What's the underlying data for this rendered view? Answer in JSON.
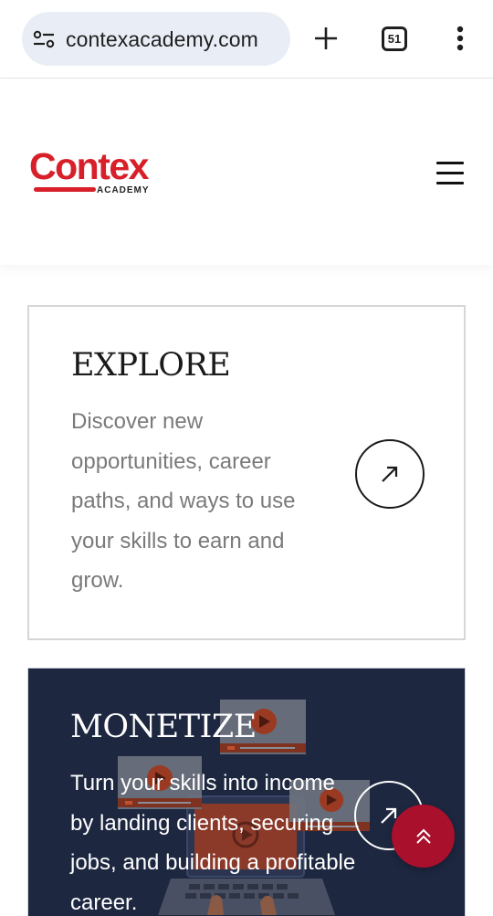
{
  "browser": {
    "url": "contexacademy.com",
    "tab_count": "51",
    "icons": {
      "site_settings": "tune-icon",
      "new_tab": "plus-icon",
      "tabs": "tab-switcher-icon",
      "menu": "more-vert-icon"
    }
  },
  "header": {
    "logo_word": "Contex",
    "logo_sub": "ACADEMY",
    "menu_icon": "hamburger-icon",
    "brand_color": "#d7202a"
  },
  "cards": {
    "explore": {
      "title": "EXPLORE",
      "description": "Discover new opportunities, career paths, and ways to use your skills to earn and grow.",
      "arrow_icon": "arrow-up-right-icon"
    },
    "monetize": {
      "title": "MONETIZE",
      "description": "Turn your skills into income by landing clients, securing jobs, and building a profitable career.",
      "arrow_icon": "arrow-up-right-icon",
      "background": "#1d2740"
    }
  },
  "scroll_top": {
    "icon": "double-chevron-up-icon",
    "color": "#a8102c"
  }
}
